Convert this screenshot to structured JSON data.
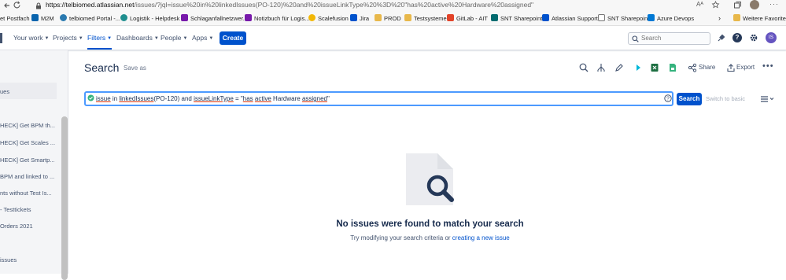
{
  "browser": {
    "url_host": "https://telbiomed.atlassian.net",
    "url_rest": "/issues/?jql=issue%20in%20linkedIssues(PO-120)%20and%20issueLinkType%20%3D%20\"has%20active%20Hardware%20assigned\"",
    "favorites": [
      {
        "label": "et Postfach",
        "icon": "mail-icon",
        "color": "#0a64ad"
      },
      {
        "label": "M2M",
        "icon": "mail-icon",
        "color": "#0a64ad"
      },
      {
        "label": "telbiomed Portal -...",
        "icon": "portal-icon",
        "color": "#2a7ab0"
      },
      {
        "label": "Logistik - Helpdesk",
        "icon": "helpdesk-icon",
        "color": "#1f8e8e"
      },
      {
        "label": "Schlaganfallnetzwer...",
        "icon": "onenote-icon",
        "color": "#7719aa"
      },
      {
        "label": "Notizbuch für Logis...",
        "icon": "onenote-icon",
        "color": "#7719aa"
      },
      {
        "label": "Scalefusion",
        "icon": "scalefusion-icon",
        "color": "#f2b705"
      },
      {
        "label": "Jira",
        "icon": "jira-icon",
        "color": "#0052cc"
      },
      {
        "label": "PROD",
        "icon": "folder-icon",
        "color": "#e8b84b"
      },
      {
        "label": "Testsysteme",
        "icon": "folder-icon",
        "color": "#e8b84b"
      },
      {
        "label": "GitLab - AIT",
        "icon": "gitlab-icon",
        "color": "#e24329"
      },
      {
        "label": "SNT Sharepoint",
        "icon": "sharepoint-icon",
        "color": "#036c70"
      },
      {
        "label": "Atlassian Support",
        "icon": "atlassian-icon",
        "color": "#0052cc"
      },
      {
        "label": "SNT Sharepoint",
        "icon": "page-icon",
        "color": "#777777"
      },
      {
        "label": "Azure Devops",
        "icon": "azure-devops-icon",
        "color": "#0078d4"
      }
    ],
    "other_favorites": "Weitere Favoriten"
  },
  "nav": {
    "your_work": "Your work",
    "projects": "Projects",
    "filters": "Filters",
    "dashboards": "Dashboards",
    "people": "People",
    "apps": "Apps",
    "create": "Create",
    "search_placeholder": "Search",
    "avatar_initials": "IS"
  },
  "sidebar": {
    "items": [
      "ues",
      "HECK] Get BPM th...",
      "HECK] Get Scales ...",
      "HECK] Get Smartp...",
      "BPM and linked to ...",
      "nts without Test Is...",
      "- Testtickets",
      "Orders 2021",
      "issues"
    ]
  },
  "main": {
    "title": "Search",
    "save_as": "Save as",
    "share": "Share",
    "export": "Export",
    "jql": {
      "t1": "issue",
      "t2": " in ",
      "t3": "linkedIssues",
      "t4": "(PO-120)",
      "t5": " and ",
      "t6": "issueLinkType",
      "t7": " = \"",
      "t8": "has",
      "t9": " ",
      "t10": "active",
      "t11": " Hardware ",
      "t12": "assigned",
      "t13": "\""
    },
    "search_button": "Search",
    "switch_to_basic": "Switch to basic",
    "empty_title": "No issues were found to match your search",
    "empty_sub_prefix": "Try modifying your search criteria or ",
    "empty_sub_link": "creating a new issue"
  },
  "colors": {
    "brand": "#0052cc",
    "focus": "#4c9aff",
    "valid": "#36b37e"
  }
}
